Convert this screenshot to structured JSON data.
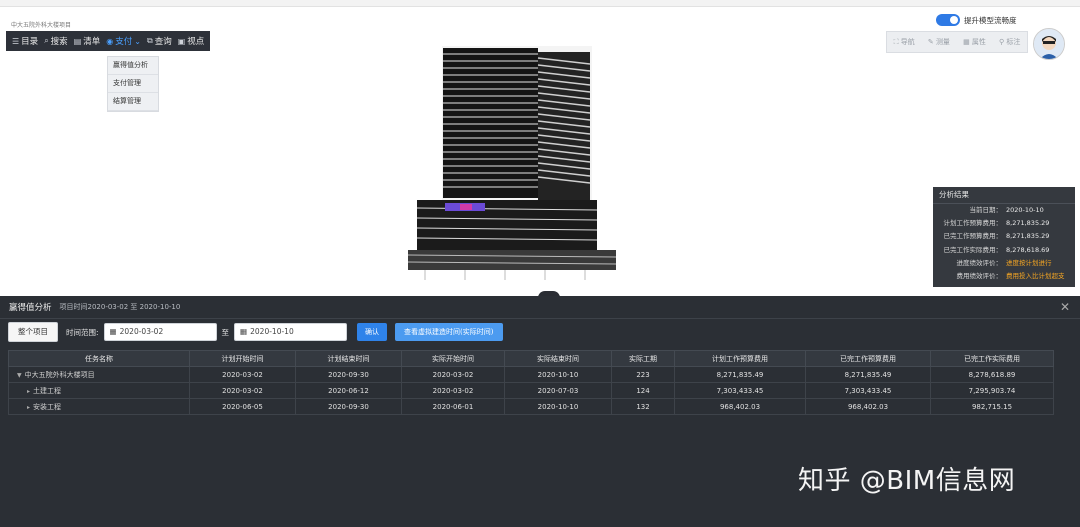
{
  "project_name": "中大五院外科大楼项目",
  "toolbar": {
    "items": [
      {
        "label": "目录",
        "icon": "list-icon"
      },
      {
        "label": "搜索",
        "icon": "search-icon"
      },
      {
        "label": "清单",
        "icon": "table-icon"
      },
      {
        "label": "支付",
        "icon": "target-icon",
        "active": true
      },
      {
        "label": "查询",
        "icon": "query-icon"
      },
      {
        "label": "视点",
        "icon": "viewpoint-icon"
      }
    ]
  },
  "dropdown": {
    "items": [
      "赢得值分析",
      "支付管理",
      "结算管理"
    ]
  },
  "toggle_label": "提升模型流畅度",
  "right_tools": {
    "items": [
      "导航",
      "测量",
      "属性",
      "标注"
    ]
  },
  "analysis_result": {
    "title": "分析结果",
    "rows": [
      {
        "label": "当前日期：",
        "value": "2020-10-10"
      },
      {
        "label": "计划工作预算费用：",
        "value": "8,271,835.29"
      },
      {
        "label": "已完工作预算费用：",
        "value": "8,271,835.29"
      },
      {
        "label": "已完工作实际费用：",
        "value": "8,278,618.69"
      },
      {
        "label": "进度绩效评价：",
        "value": "进度按计划进行",
        "status": "warn"
      },
      {
        "label": "费用绩效评价：",
        "value": "费用投入比计划超支",
        "status": "warn"
      }
    ]
  },
  "bottom_panel": {
    "title": "赢得值分析",
    "subtitle": "项目时间2020-03-02 至 2020-10-10",
    "whole_project_button": "整个项目",
    "time_range_label": "时间范围:",
    "start_date": "2020-03-02",
    "to_label": "至",
    "end_date": "2020-10-10",
    "confirm_button": "确认",
    "view_button": "查看虚拟建造时间(实际时间)"
  },
  "table": {
    "headers": [
      "任务名称",
      "计划开始时间",
      "计划结束时间",
      "实际开始时间",
      "实际结束时间",
      "实际工期",
      "计划工作预算费用",
      "已完工作预算费用",
      "已完工作实际费用"
    ],
    "rows": [
      [
        "中大五院外科大楼项目",
        "2020-03-02",
        "2020-09-30",
        "2020-03-02",
        "2020-10-10",
        "223",
        "8,271,835.49",
        "8,271,835.49",
        "8,278,618.89"
      ],
      [
        "土建工程",
        "2020-03-02",
        "2020-06-12",
        "2020-03-02",
        "2020-07-03",
        "124",
        "7,303,433.45",
        "7,303,433.45",
        "7,295,903.74"
      ],
      [
        "安装工程",
        "2020-06-05",
        "2020-09-30",
        "2020-06-01",
        "2020-10-10",
        "132",
        "968,402.03",
        "968,402.03",
        "982,715.15"
      ]
    ]
  },
  "watermark": "知乎 @BIM信息网",
  "colors": {
    "accent": "#2f83ea",
    "panel": "#2b2f35",
    "warn": "#f5a623"
  }
}
